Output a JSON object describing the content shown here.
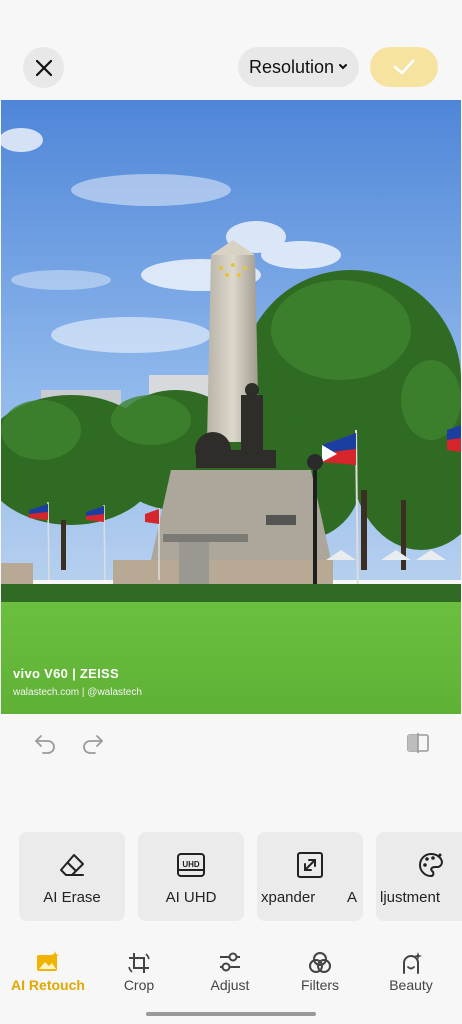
{
  "header": {
    "close_icon": "close-icon",
    "resolution_label": "Resolution",
    "confirm_icon": "check-icon",
    "accent_color": "#f6e3a0"
  },
  "photo": {
    "watermark_line1": "vivo V60 | ZEISS",
    "watermark_line2": "walastech.com | @walastech"
  },
  "history": {
    "undo_icon": "undo-icon",
    "redo_icon": "redo-icon",
    "compare_icon": "compare-icon"
  },
  "tools": [
    {
      "label": "AI Erase",
      "icon": "eraser-icon"
    },
    {
      "label": "AI UHD",
      "icon": "uhd-icon"
    },
    {
      "label": "xpander",
      "icon": "expand-icon"
    },
    {
      "label": "ljustment",
      "icon": "palette-icon"
    }
  ],
  "tabs": [
    {
      "label": "AI Retouch",
      "icon": "ai-retouch-icon",
      "active": true
    },
    {
      "label": "Crop",
      "icon": "crop-rotate-icon",
      "active": false
    },
    {
      "label": "Adjust",
      "icon": "sliders-icon",
      "active": false
    },
    {
      "label": "Filters",
      "icon": "filters-icon",
      "active": false
    },
    {
      "label": "Beauty",
      "icon": "beauty-icon",
      "active": false
    }
  ],
  "active_color": "#e0a800"
}
